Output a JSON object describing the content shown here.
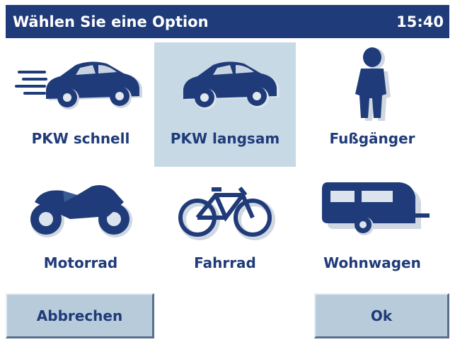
{
  "titlebar": {
    "title": "Wählen Sie eine Option",
    "time": "15:40"
  },
  "options": [
    {
      "label": "PKW schnell",
      "icon": "fast-car-icon",
      "selected": false
    },
    {
      "label": "PKW langsam",
      "icon": "car-icon",
      "selected": true
    },
    {
      "label": "Fußgänger",
      "icon": "pedestrian-icon",
      "selected": false
    },
    {
      "label": "Motorrad",
      "icon": "motorcycle-icon",
      "selected": false
    },
    {
      "label": "Fahrrad",
      "icon": "bicycle-icon",
      "selected": false
    },
    {
      "label": "Wohnwagen",
      "icon": "caravan-icon",
      "selected": false
    }
  ],
  "buttons": {
    "cancel": "Abbrechen",
    "ok": "Ok"
  },
  "colors": {
    "primary": "#1f3b79",
    "selected_bg": "#c7d9e5",
    "button_bg": "#b8cbdb"
  }
}
